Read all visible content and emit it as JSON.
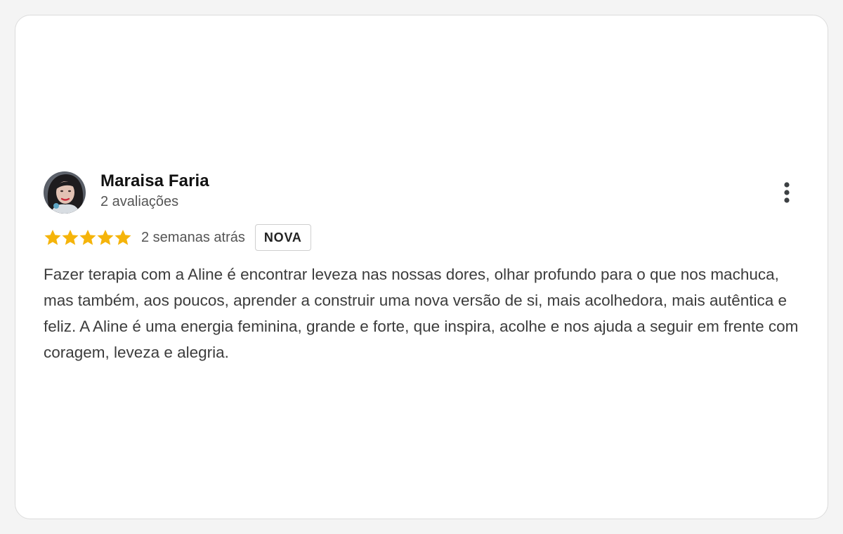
{
  "review": {
    "author": {
      "name": "Maraisa Faria",
      "meta": "2 avaliações",
      "avatar_icon": "user-photo-avatar"
    },
    "rating": {
      "value": 5,
      "max": 5,
      "star_color": "#f5b40a"
    },
    "time_ago": "2 semanas atrás",
    "badge": "NOVA",
    "text": "Fazer terapia com a Aline é encontrar leveza nas nossas dores, olhar profundo para o que nos machuca, mas também, aos poucos, aprender a construir uma nova versão de si, mais acolhedora, mais autêntica e feliz. A Aline é uma energia feminina, grande e forte, que inspira, acolhe e nos ajuda a seguir em frente com coragem, leveza e alegria.",
    "menu_icon": "more-vertical-icon"
  }
}
